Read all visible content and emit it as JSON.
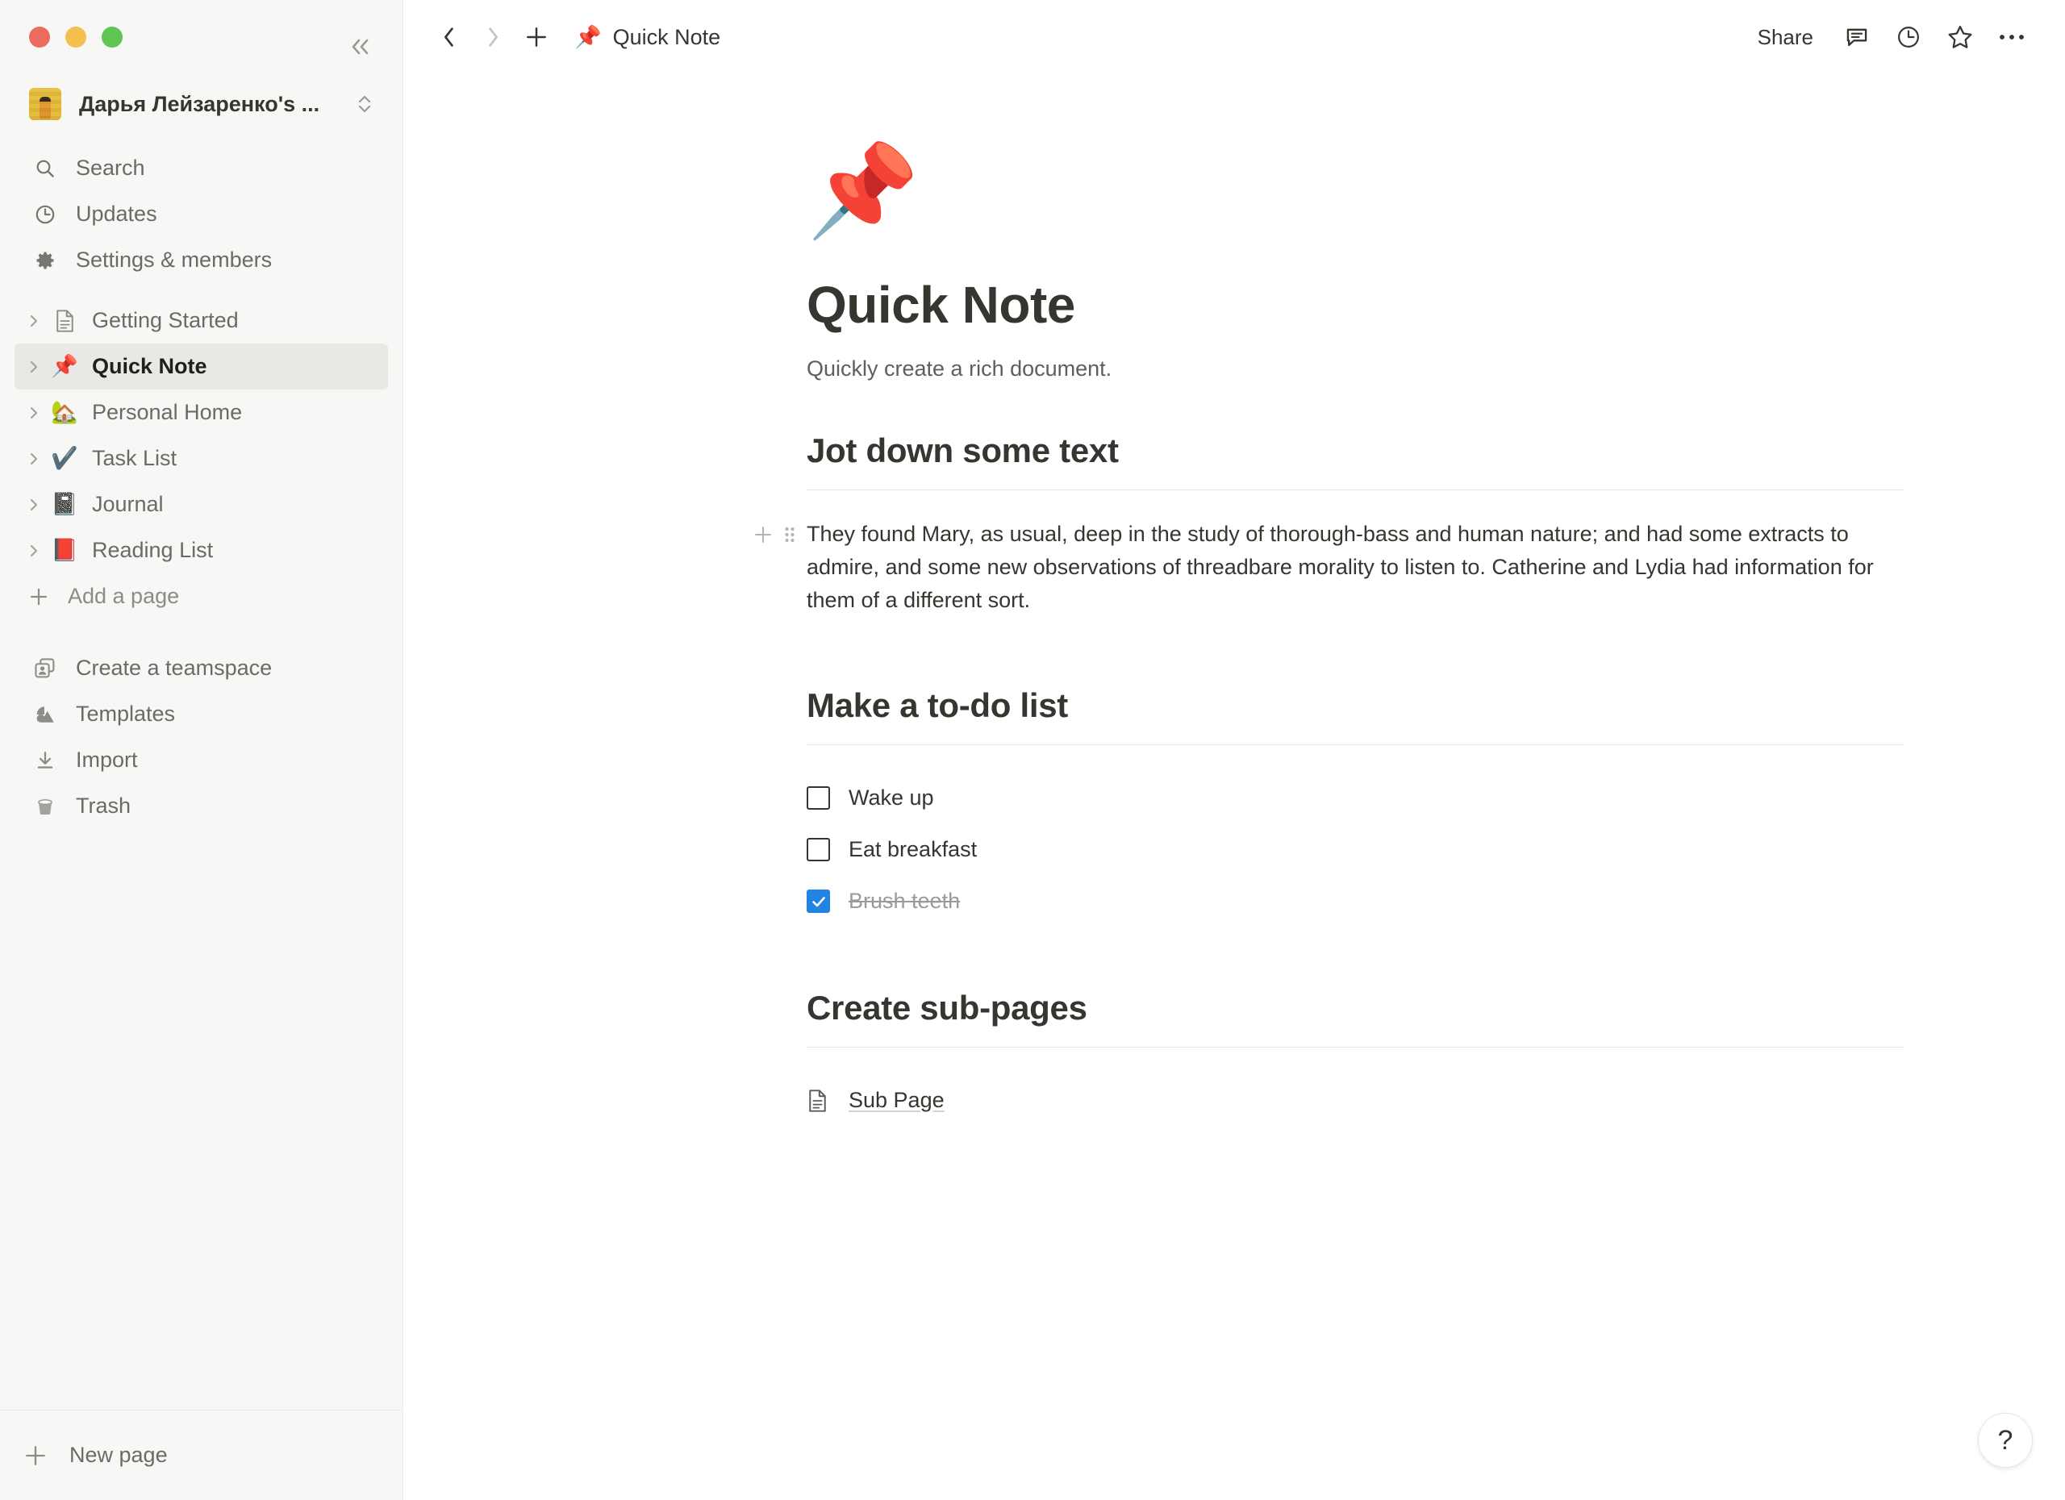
{
  "window": {
    "traffic_lights": [
      "close",
      "minimize",
      "maximize"
    ],
    "colors": {
      "close": "#ed6a5e",
      "minimize": "#f5bf4f",
      "maximize": "#61c554"
    }
  },
  "sidebar": {
    "workspace": {
      "name": "Дарья Лейзаренко's ...",
      "avatar": "user-photo"
    },
    "collapse_icon": "double-chevron-left-icon",
    "nav": [
      {
        "label": "Search",
        "icon": "search-icon"
      },
      {
        "label": "Updates",
        "icon": "clock-icon"
      },
      {
        "label": "Settings & members",
        "icon": "gear-icon"
      }
    ],
    "pages": [
      {
        "label": "Getting Started",
        "icon": "document-icon",
        "emoji": "",
        "selected": false
      },
      {
        "label": "Quick Note",
        "icon": "",
        "emoji": "📌",
        "selected": true
      },
      {
        "label": "Personal Home",
        "icon": "",
        "emoji": "🏡",
        "selected": false
      },
      {
        "label": "Task List",
        "icon": "",
        "emoji": "✔️",
        "selected": false
      },
      {
        "label": "Journal",
        "icon": "",
        "emoji": "📓",
        "selected": false
      },
      {
        "label": "Reading List",
        "icon": "",
        "emoji": "📕",
        "selected": false
      }
    ],
    "add_page": {
      "label": "Add a page",
      "icon": "plus-icon"
    },
    "tools": [
      {
        "label": "Create a teamspace",
        "icon": "teamspace-icon"
      },
      {
        "label": "Templates",
        "icon": "templates-icon"
      },
      {
        "label": "Import",
        "icon": "import-icon"
      },
      {
        "label": "Trash",
        "icon": "trash-icon"
      }
    ],
    "footer": {
      "label": "New page",
      "icon": "plus-icon"
    }
  },
  "topbar": {
    "back_icon": "chevron-left-icon",
    "forward_icon": "chevron-right-icon",
    "new_icon": "plus-icon",
    "breadcrumb_emoji": "📌",
    "breadcrumb": "Quick Note",
    "share_label": "Share",
    "comment_icon": "comment-icon",
    "history_icon": "clock-icon",
    "favorite_icon": "star-icon",
    "more_icon": "more-horizontal-icon"
  },
  "document": {
    "emoji": "📌",
    "title": "Quick Note",
    "subtitle": "Quickly create a rich document.",
    "sections": [
      {
        "heading": "Jot down some text",
        "paragraph": "They found Mary, as usual, deep in the study of thorough-bass and human nature; and had some extracts to admire, and some new observations of threadbare morality to listen to. Catherine and Lydia had information for them of a different sort."
      },
      {
        "heading": "Make a to-do list",
        "todos": [
          {
            "label": "Wake up",
            "checked": false
          },
          {
            "label": "Eat breakfast",
            "checked": false
          },
          {
            "label": "Brush teeth",
            "checked": true
          }
        ]
      },
      {
        "heading": "Create sub-pages",
        "subpage": {
          "label": "Sub Page",
          "icon": "document-icon"
        }
      }
    ],
    "block_handle_plus": "plus-icon",
    "block_handle_drag": "drag-handle-icon"
  },
  "help": {
    "label": "?",
    "icon": "question-mark-icon"
  },
  "accent_colors": {
    "checkbox_checked": "#2383e2",
    "selected_row": "#e9e8e5",
    "sidebar_bg": "#f7f7f5",
    "text_primary": "#37352f",
    "text_secondary": "#6a6a67",
    "done_text": "#9b9a97"
  }
}
